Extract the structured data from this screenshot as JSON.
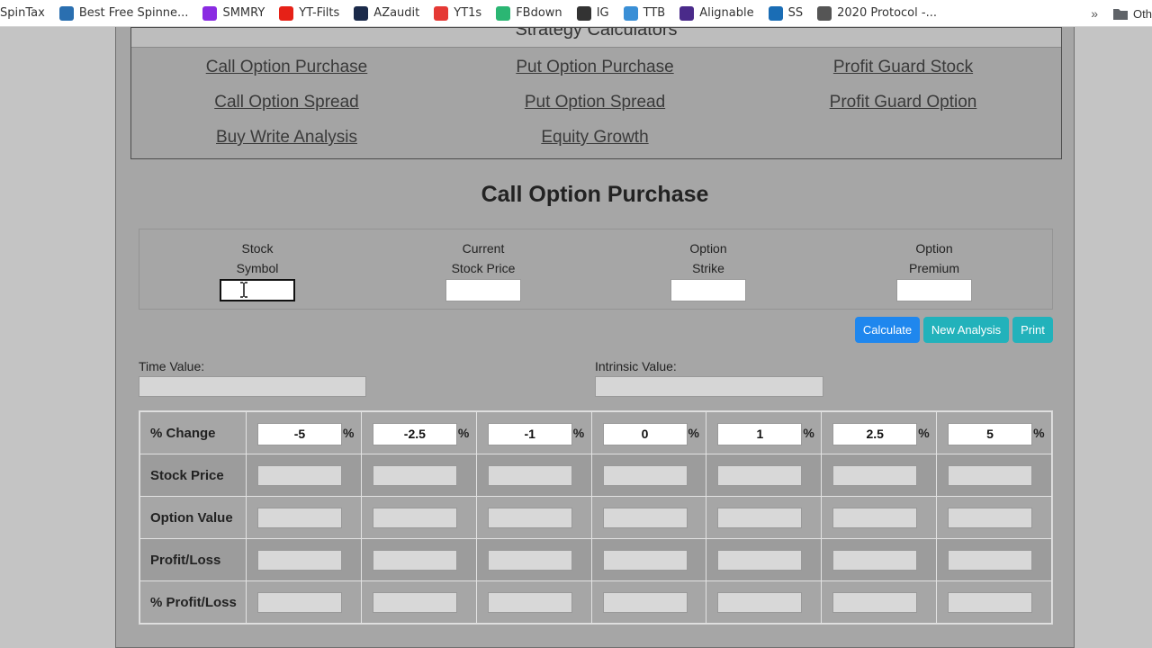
{
  "bookmarks": [
    {
      "label": "SpinTax",
      "icon": "none",
      "color": "#ffffff"
    },
    {
      "label": "Best Free Spinne...",
      "icon": "bird-icon",
      "color": "#2a6fb0"
    },
    {
      "label": "SMMRY",
      "icon": "arrow-icon",
      "color": "#8a2be2"
    },
    {
      "label": "YT-Filts",
      "icon": "youtube-icon",
      "color": "#e62117"
    },
    {
      "label": "AZaudit",
      "icon": "az-icon",
      "color": "#1b2a4a"
    },
    {
      "label": "YT1s",
      "icon": "yt1s-icon",
      "color": "#e53935"
    },
    {
      "label": "FBdown",
      "icon": "fbdown-icon",
      "color": "#2bb673"
    },
    {
      "label": "IG",
      "icon": "ig-icon",
      "color": "#333333"
    },
    {
      "label": "TTB",
      "icon": "ttb-icon",
      "color": "#3a8fd6"
    },
    {
      "label": "Alignable",
      "icon": "alignable-icon",
      "color": "#4a2a8a"
    },
    {
      "label": "SS",
      "icon": "ss-icon",
      "color": "#1a6db5"
    },
    {
      "label": "2020 Protocol -...",
      "icon": "globe-icon",
      "color": "#555555"
    }
  ],
  "bookmarks_more": "»",
  "bookmarks_other": "Oth",
  "strategy": {
    "header": "Strategy Calculators",
    "links": [
      "Call Option Purchase",
      "Put Option Purchase",
      "Profit Guard Stock",
      "Call Option Spread",
      "Put Option Spread",
      "Profit Guard Option",
      "Buy Write Analysis",
      "Equity Growth",
      ""
    ]
  },
  "title": "Call Option Purchase",
  "inputs": [
    {
      "line1": "Stock",
      "line2": "Symbol",
      "value": ""
    },
    {
      "line1": "Current",
      "line2": "Stock Price",
      "value": ""
    },
    {
      "line1": "Option",
      "line2": "Strike",
      "value": ""
    },
    {
      "line1": "Option",
      "line2": "Premium",
      "value": ""
    }
  ],
  "buttons": {
    "calculate": "Calculate",
    "new_analysis": "New Analysis",
    "print": "Print"
  },
  "time_value_label": "Time Value:",
  "intrinsic_value_label": "Intrinsic Value:",
  "grid": {
    "pct_row_label": "% Change",
    "pct_values": [
      "-5",
      "-2.5",
      "-1",
      "0",
      "1",
      "2.5",
      "5"
    ],
    "pct_sign": "%",
    "rows": [
      "Stock Price",
      "Option Value",
      "Profit/Loss",
      "% Profit/Loss"
    ]
  },
  "colors": {
    "calculate": "#1f87ee",
    "teal": "#22b2bb",
    "page_bg": "#a6a6a6"
  }
}
